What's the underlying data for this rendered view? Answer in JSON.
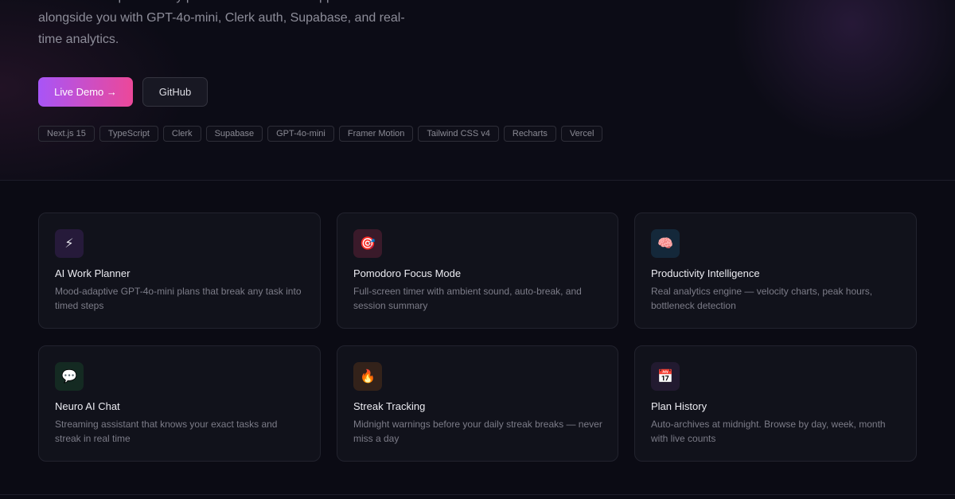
{
  "hero": {
    "description": "A full-stack AI productivity platform — not a todo app. Built to think alongside you with GPT-4o-mini, Clerk auth, Supabase, and real-time analytics.",
    "demo_label": "Live Demo →",
    "github_label": "GitHub",
    "tags": [
      "Next.js 15",
      "TypeScript",
      "Clerk",
      "Supabase",
      "GPT-4o-mini",
      "Framer Motion",
      "Tailwind CSS v4",
      "Recharts",
      "Vercel"
    ]
  },
  "features": [
    {
      "icon": "lightning-icon",
      "glyph": "⚡",
      "icon_bg": "#261a3a",
      "title": "AI Work Planner",
      "desc": "Mood-adaptive GPT-4o-mini plans that break any task into timed steps"
    },
    {
      "icon": "target-icon",
      "glyph": "🎯",
      "icon_bg": "#3a1a2a",
      "title": "Pomodoro Focus Mode",
      "desc": "Full-screen timer with ambient sound, auto-break, and session summary"
    },
    {
      "icon": "brain-icon",
      "glyph": "🧠",
      "icon_bg": "#14283a",
      "title": "Productivity Intelligence",
      "desc": "Real analytics engine — velocity charts, peak hours, bottleneck detection"
    },
    {
      "icon": "chat-icon",
      "glyph": "💬",
      "icon_bg": "#142a22",
      "title": "Neuro AI Chat",
      "desc": "Streaming assistant that knows your exact tasks and streak in real time"
    },
    {
      "icon": "fire-icon",
      "glyph": "🔥",
      "icon_bg": "#33221a",
      "title": "Streak Tracking",
      "desc": "Midnight warnings before your daily streak breaks — never miss a day"
    },
    {
      "icon": "calendar-icon",
      "glyph": "📅",
      "icon_bg": "#221a30",
      "title": "Plan History",
      "desc": "Auto-archives at midnight. Browse by day, week, month with live counts"
    }
  ]
}
